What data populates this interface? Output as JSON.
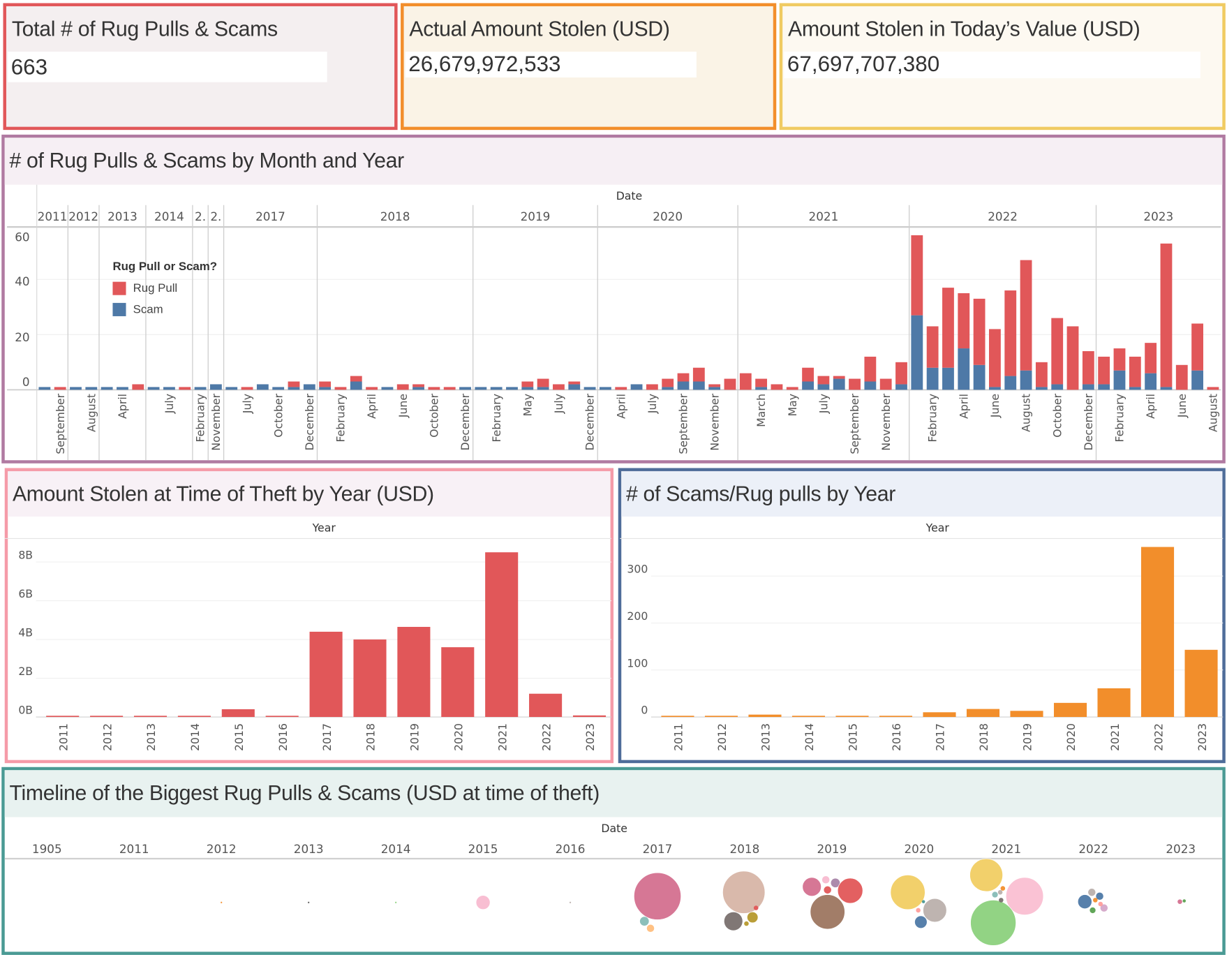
{
  "kpis": [
    {
      "title": "Total # of Rug Pulls & Scams",
      "value": "663",
      "border": "#e15759",
      "bg": "#f4eff0"
    },
    {
      "title": "Actual Amount Stolen (USD)",
      "value": "26,679,972,533",
      "border": "#f28e2b",
      "bg": "#faf3e6"
    },
    {
      "title": "Amount Stolen in Today’s Value (USD)",
      "value": "67,697,707,380",
      "border": "#f0cb62",
      "bg": "#fdf9f1"
    }
  ],
  "colors": {
    "rug_pull": "#e15759",
    "scam": "#4e79a7",
    "count_bar": "#f28e2b"
  },
  "chart_data": [
    {
      "type": "bar",
      "stacked": true,
      "title": "# of Rug Pulls & Scams by Month and Year",
      "xlabel": "Date",
      "ylabel": "",
      "y_ticks": [
        "0",
        "20",
        "40",
        "60"
      ],
      "ylim": [
        0,
        59
      ],
      "grid": true,
      "legend": {
        "title": "Rug Pull or Scam?",
        "placement": "top-left",
        "items": [
          {
            "name": "Rug Pull",
            "color": "#e15759"
          },
          {
            "name": "Scam",
            "color": "#4e79a7"
          }
        ]
      },
      "years": [
        {
          "label": "2011",
          "months": [
            {
              "label": "",
              "scam": 1,
              "rug": 0
            },
            {
              "label": "September",
              "scam": 0,
              "rug": 1
            }
          ]
        },
        {
          "label": "2012",
          "months": [
            {
              "label": "",
              "scam": 1,
              "rug": 0
            },
            {
              "label": "August",
              "scam": 1,
              "rug": 0
            }
          ]
        },
        {
          "label": "2013",
          "months": [
            {
              "label": "",
              "scam": 1,
              "rug": 0
            },
            {
              "label": "April",
              "scam": 1,
              "rug": 0
            },
            {
              "label": "",
              "scam": 0,
              "rug": 2
            }
          ]
        },
        {
          "label": "2014",
          "months": [
            {
              "label": "",
              "scam": 1,
              "rug": 0
            },
            {
              "label": "July",
              "scam": 1,
              "rug": 0
            },
            {
              "label": "",
              "scam": 0,
              "rug": 1
            }
          ]
        },
        {
          "label": "2.",
          "months": [
            {
              "label": "February",
              "scam": 1,
              "rug": 0
            }
          ]
        },
        {
          "label": "2.",
          "months": [
            {
              "label": "November",
              "scam": 2,
              "rug": 0
            }
          ]
        },
        {
          "label": "2017",
          "months": [
            {
              "label": "",
              "scam": 1,
              "rug": 0
            },
            {
              "label": "July",
              "scam": 0,
              "rug": 1
            },
            {
              "label": "",
              "scam": 2,
              "rug": 0
            },
            {
              "label": "October",
              "scam": 1,
              "rug": 0
            },
            {
              "label": "",
              "scam": 1,
              "rug": 2
            },
            {
              "label": "December",
              "scam": 2,
              "rug": 0
            }
          ]
        },
        {
          "label": "2018",
          "months": [
            {
              "label": "",
              "scam": 1,
              "rug": 2
            },
            {
              "label": "February",
              "scam": 0,
              "rug": 1
            },
            {
              "label": "",
              "scam": 3,
              "rug": 2
            },
            {
              "label": "April",
              "scam": 0,
              "rug": 1
            },
            {
              "label": "",
              "scam": 1,
              "rug": 0
            },
            {
              "label": "June",
              "scam": 0,
              "rug": 2
            },
            {
              "label": "",
              "scam": 1,
              "rug": 1
            },
            {
              "label": "October",
              "scam": 0,
              "rug": 1
            },
            {
              "label": "",
              "scam": 0,
              "rug": 1
            },
            {
              "label": "December",
              "scam": 1,
              "rug": 0
            }
          ]
        },
        {
          "label": "2019",
          "months": [
            {
              "label": "",
              "scam": 1,
              "rug": 0
            },
            {
              "label": "February",
              "scam": 1,
              "rug": 0
            },
            {
              "label": "",
              "scam": 1,
              "rug": 0
            },
            {
              "label": "May",
              "scam": 1,
              "rug": 2
            },
            {
              "label": "",
              "scam": 1,
              "rug": 3
            },
            {
              "label": "July",
              "scam": 0,
              "rug": 2
            },
            {
              "label": "",
              "scam": 2,
              "rug": 1
            },
            {
              "label": "December",
              "scam": 1,
              "rug": 0
            }
          ]
        },
        {
          "label": "2020",
          "months": [
            {
              "label": "",
              "scam": 1,
              "rug": 0
            },
            {
              "label": "April",
              "scam": 0,
              "rug": 1
            },
            {
              "label": "",
              "scam": 2,
              "rug": 0
            },
            {
              "label": "July",
              "scam": 0,
              "rug": 2
            },
            {
              "label": "",
              "scam": 1,
              "rug": 3
            },
            {
              "label": "September",
              "scam": 3,
              "rug": 3
            },
            {
              "label": "",
              "scam": 3,
              "rug": 5
            },
            {
              "label": "November",
              "scam": 1,
              "rug": 1
            },
            {
              "label": "",
              "scam": 0,
              "rug": 4
            }
          ]
        },
        {
          "label": "2021",
          "months": [
            {
              "label": "",
              "scam": 0,
              "rug": 6
            },
            {
              "label": "March",
              "scam": 1,
              "rug": 3
            },
            {
              "label": "",
              "scam": 0,
              "rug": 2
            },
            {
              "label": "May",
              "scam": 0,
              "rug": 1
            },
            {
              "label": "",
              "scam": 3,
              "rug": 5
            },
            {
              "label": "July",
              "scam": 2,
              "rug": 3
            },
            {
              "label": "",
              "scam": 4,
              "rug": 1
            },
            {
              "label": "September",
              "scam": 0,
              "rug": 4
            },
            {
              "label": "",
              "scam": 3,
              "rug": 9
            },
            {
              "label": "November",
              "scam": 0,
              "rug": 4
            },
            {
              "label": "",
              "scam": 2,
              "rug": 8
            }
          ]
        },
        {
          "label": "2022",
          "months": [
            {
              "label": "",
              "scam": 27,
              "rug": 29
            },
            {
              "label": "February",
              "scam": 8,
              "rug": 15
            },
            {
              "label": "",
              "scam": 8,
              "rug": 29
            },
            {
              "label": "April",
              "scam": 15,
              "rug": 20
            },
            {
              "label": "",
              "scam": 9,
              "rug": 24
            },
            {
              "label": "June",
              "scam": 1,
              "rug": 21
            },
            {
              "label": "",
              "scam": 5,
              "rug": 31
            },
            {
              "label": "August",
              "scam": 7,
              "rug": 40
            },
            {
              "label": "",
              "scam": 1,
              "rug": 9
            },
            {
              "label": "October",
              "scam": 2,
              "rug": 24
            },
            {
              "label": "",
              "scam": 0,
              "rug": 23
            },
            {
              "label": "December",
              "scam": 2,
              "rug": 12
            }
          ]
        },
        {
          "label": "2023",
          "months": [
            {
              "label": "",
              "scam": 2,
              "rug": 10
            },
            {
              "label": "February",
              "scam": 7,
              "rug": 8
            },
            {
              "label": "",
              "scam": 1,
              "rug": 11
            },
            {
              "label": "April",
              "scam": 6,
              "rug": 11
            },
            {
              "label": "",
              "scam": 1,
              "rug": 52
            },
            {
              "label": "June",
              "scam": 0,
              "rug": 9
            },
            {
              "label": "",
              "scam": 7,
              "rug": 17
            },
            {
              "label": "August",
              "scam": 0,
              "rug": 1
            }
          ]
        }
      ]
    },
    {
      "type": "bar",
      "title": "Amount Stolen at Time of Theft by Year (USD)",
      "xlabel": "Year",
      "ylabel": "",
      "categories": [
        "2011",
        "2012",
        "2013",
        "2014",
        "2015",
        "2016",
        "2017",
        "2018",
        "2019",
        "2020",
        "2021",
        "2022",
        "2023"
      ],
      "values_usd_billions": [
        0.001,
        0.001,
        0.001,
        0.001,
        0.4,
        0.001,
        4.4,
        4.0,
        4.65,
        3.6,
        8.5,
        1.2,
        0.08
      ],
      "y_ticks": [
        "0B",
        "2B",
        "4B",
        "6B",
        "8B"
      ],
      "ylim": [
        0,
        8.8
      ],
      "color": "#e15759",
      "grid": true
    },
    {
      "type": "bar",
      "title": "# of Scams/Rug pulls by Year",
      "xlabel": "Year",
      "ylabel": "",
      "categories": [
        "2011",
        "2012",
        "2013",
        "2014",
        "2015",
        "2016",
        "2017",
        "2018",
        "2019",
        "2020",
        "2021",
        "2022",
        "2023"
      ],
      "values": [
        2,
        2,
        5,
        2,
        1,
        2,
        10,
        17,
        13,
        30,
        61,
        362,
        143
      ],
      "y_ticks": [
        "0",
        "100",
        "200",
        "300"
      ],
      "ylim": [
        0,
        360
      ],
      "color": "#f28e2b",
      "grid": true
    },
    {
      "type": "scatter",
      "title": "Timeline of the Biggest Rug Pulls & Scams (USD at time of theft)",
      "xlabel": "Date",
      "x_ticks": [
        "1905",
        "2011",
        "2012",
        "2013",
        "2014",
        "2015",
        "2016",
        "2017",
        "2018",
        "2019",
        "2020",
        "2021",
        "2022",
        "2023"
      ],
      "size_measure": "USD at time of theft (billions, estimated)",
      "bubbles": [
        {
          "date": 2012.5,
          "amount_b": 0.0035,
          "color": "#f28e2b"
        },
        {
          "date": 2013.5,
          "amount_b": 0.0035,
          "color": "#555555"
        },
        {
          "date": 2014.5,
          "amount_b": 0.0035,
          "color": "#8cd17d"
        },
        {
          "date": 2015.5,
          "amount_b": 0.28,
          "color": "#f8bbd0"
        },
        {
          "date": 2016.5,
          "amount_b": 0.0035,
          "color": "#bab0ac"
        },
        {
          "date": 2017.5,
          "amount_b": 3.15,
          "color": "#d4708f"
        },
        {
          "date": 2017.35,
          "amount_b": 0.126,
          "color": "#86bcb6"
        },
        {
          "date": 2017.42,
          "amount_b": 0.0875,
          "color": "#ffbe7d"
        },
        {
          "date": 2018.49,
          "amount_b": 2.55,
          "color": "#d7b5a6"
        },
        {
          "date": 2018.37,
          "amount_b": 0.5,
          "color": "#79706e"
        },
        {
          "date": 2018.59,
          "amount_b": 0.17,
          "color": "#b6992d"
        },
        {
          "date": 2018.52,
          "amount_b": 0.03,
          "color": "#b6992d"
        },
        {
          "date": 2018.63,
          "amount_b": 0.03,
          "color": "#e15759"
        },
        {
          "date": 2019.27,
          "amount_b": 0.5,
          "color": "#d4708f"
        },
        {
          "date": 2019.43,
          "amount_b": 0.0875,
          "color": "#f8bbd0"
        },
        {
          "date": 2019.54,
          "amount_b": 0.126,
          "color": "#a884a8"
        },
        {
          "date": 2019.45,
          "amount_b": 0.0875,
          "color": "#e15759"
        },
        {
          "date": 2019.71,
          "amount_b": 0.9,
          "color": "#e15759"
        },
        {
          "date": 2019.45,
          "amount_b": 1.7,
          "color": "#9d7660"
        },
        {
          "date": 2020.37,
          "amount_b": 1.7,
          "color": "#f1ce63"
        },
        {
          "date": 2020.68,
          "amount_b": 0.79,
          "color": "#bab0ac"
        },
        {
          "date": 2020.52,
          "amount_b": 0.22,
          "color": "#4e79a7"
        },
        {
          "date": 2020.49,
          "amount_b": 0.03,
          "color": "#ff9d9a"
        },
        {
          "date": 2020.55,
          "amount_b": 0.014,
          "color": "#499894"
        },
        {
          "date": 2021.27,
          "amount_b": 1.54,
          "color": "#f1ce63"
        },
        {
          "date": 2021.71,
          "amount_b": 2.0,
          "color": "#fabfd2"
        },
        {
          "date": 2021.35,
          "amount_b": 2.94,
          "color": "#8cd17d"
        },
        {
          "date": 2021.37,
          "amount_b": 0.056,
          "color": "#86bcb6"
        },
        {
          "date": 2021.44,
          "amount_b": 0.03,
          "color": "#79706e"
        },
        {
          "date": 2021.46,
          "amount_b": 0.03,
          "color": "#f28e2b"
        },
        {
          "date": 2021.43,
          "amount_b": 0.03,
          "color": "#bab0ac"
        },
        {
          "date": 2022.4,
          "amount_b": 0.28,
          "color": "#4e79a7"
        },
        {
          "date": 2022.48,
          "amount_b": 0.0875,
          "color": "#bab0ac"
        },
        {
          "date": 2022.57,
          "amount_b": 0.0875,
          "color": "#4e79a7"
        },
        {
          "date": 2022.62,
          "amount_b": 0.0875,
          "color": "#d4a6c8"
        },
        {
          "date": 2022.49,
          "amount_b": 0.056,
          "color": "#59a14f"
        },
        {
          "date": 2022.52,
          "amount_b": 0.03,
          "color": "#f28e2b"
        },
        {
          "date": 2022.58,
          "amount_b": 0.03,
          "color": "#ff9d9a"
        },
        {
          "date": 2023.49,
          "amount_b": 0.03,
          "color": "#d4708f"
        },
        {
          "date": 2023.54,
          "amount_b": 0.014,
          "color": "#59a14f"
        }
      ]
    }
  ]
}
